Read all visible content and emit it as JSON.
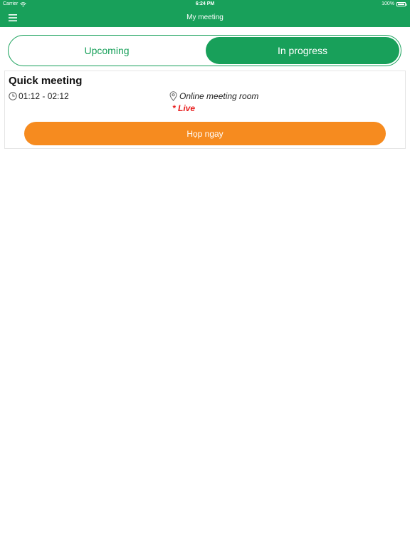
{
  "status_bar": {
    "carrier": "Carrier",
    "time": "6:24 PM",
    "battery": "100%"
  },
  "nav": {
    "title": "My meeting",
    "menu_icon": "hamburger-menu-icon"
  },
  "tabs": [
    {
      "label": "Upcoming",
      "selected": false
    },
    {
      "label": "In progress",
      "selected": true
    }
  ],
  "meeting": {
    "title": "Quick meeting",
    "time_range": "01:12 - 02:12",
    "location": "Online meeting room",
    "status": "* Live",
    "join_label": "Họp ngay"
  },
  "colors": {
    "brand_green": "#18a05a",
    "join_orange": "#f68b1f",
    "live_red": "#e81c1c"
  }
}
